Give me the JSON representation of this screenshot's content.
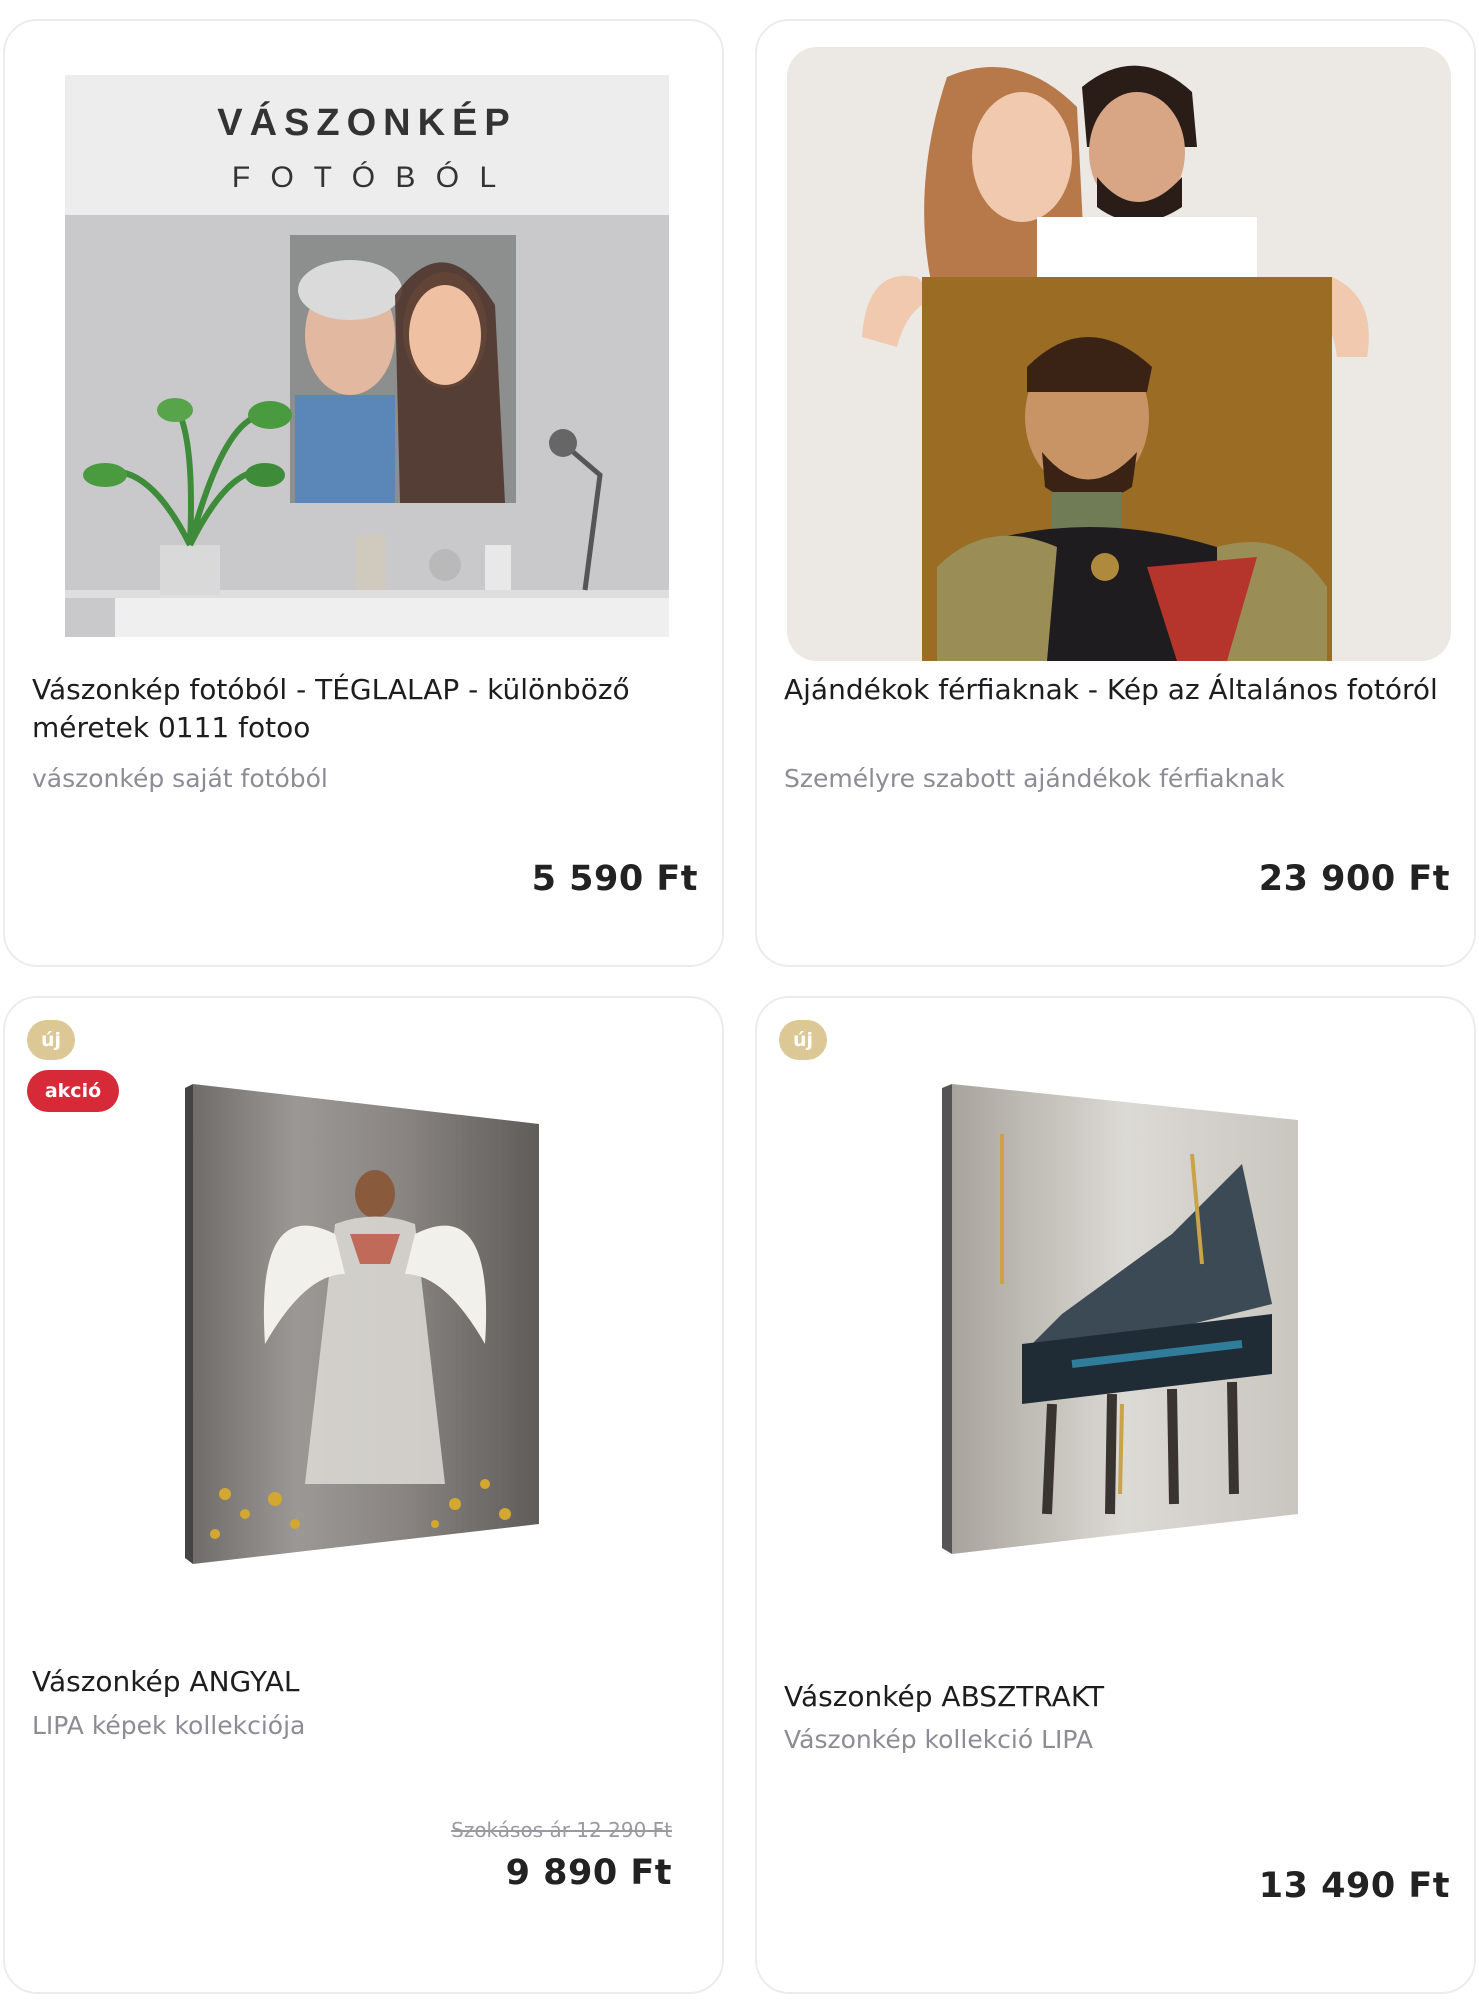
{
  "products": [
    {
      "image_text": {
        "line1": "VÁSZONKÉP",
        "line2": "F O T Ó B Ó L"
      },
      "title": "Vászonkép fotóból - TÉGLALAP - különböző méretek 0111 fotoo",
      "subtitle": "vászonkép saját fotóból",
      "price": "5 590 Ft"
    },
    {
      "title": "Ajándékok férfiaknak - Kép az Általános fotóról",
      "subtitle": "Személyre szabott ajándékok férfiaknak",
      "price": "23 900 Ft"
    },
    {
      "badges": {
        "new": "új",
        "sale": "akció"
      },
      "title": "Vászonkép ANGYAL",
      "subtitle": "LIPA képek kollekciója",
      "old_price": "Szokásos ár 12 290 Ft",
      "price": "9 890 Ft"
    },
    {
      "badges": {
        "new": "új"
      },
      "title": "Vászonkép ABSZTRAKT",
      "subtitle": "Vászonkép kollekció LIPA",
      "price": "13 490 Ft"
    }
  ],
  "colors": {
    "badge_new": "#dcc895",
    "badge_sale": "#d62a38",
    "card_border": "#ececef",
    "subtitle": "#8e8b94"
  }
}
